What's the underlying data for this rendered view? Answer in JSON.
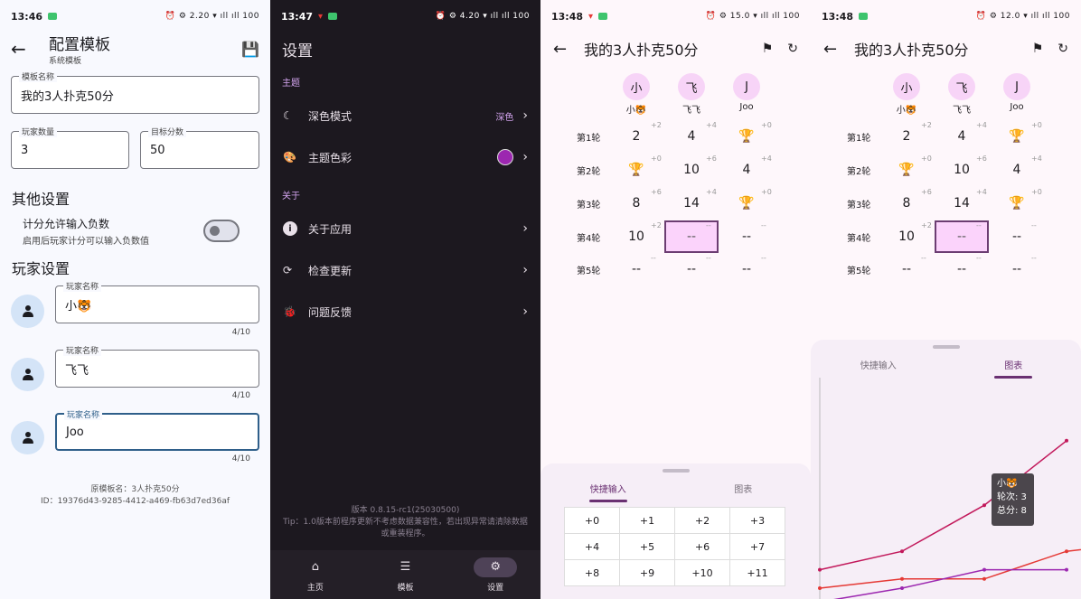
{
  "p1": {
    "time": "13:46",
    "status_right": "⏰ ⚙ 2.20 ▾ ıll ıll 100",
    "title": "配置模板",
    "subtitle": "系统模板",
    "template_name_label": "模板名称",
    "template_name_value": "我的3人扑克50分",
    "player_count_label": "玩家数量",
    "player_count_value": "3",
    "target_label": "目标分数",
    "target_value": "50",
    "other_settings": "其他设置",
    "neg_title": "计分允许输入负数",
    "neg_desc": "启用后玩家计分可以输入负数值",
    "players_section": "玩家设置",
    "player_label": "玩家名称",
    "players": [
      "小🐯",
      "飞飞",
      "Joo"
    ],
    "counters": [
      "4/10",
      "4/10",
      "4/10"
    ],
    "origin": "原模板名：3人扑克50分",
    "id": "ID：19376d43-9285-4412-a469-fb63d7ed36af"
  },
  "p2": {
    "time": "13:47",
    "status_right": "⏰ ⚙ 4.20 ▾ ıll ıll 100",
    "title": "设置",
    "sect_theme": "主题",
    "dark_mode": "深色模式",
    "dark_value": "深色",
    "theme_color": "主题色彩",
    "sect_about": "关于",
    "about_app": "关于应用",
    "check_update": "检查更新",
    "feedback": "问题反馈",
    "version": "版本 0.8.15-rc1(25030500)",
    "tip": "Tip：1.0版本前程序更新不考虑数据兼容性，若出现异常请清除数据或重装程序。",
    "nav": [
      "主页",
      "模板",
      "设置"
    ],
    "accent": "#9c27b0"
  },
  "p3": {
    "time": "13:48",
    "status_right": "⏰ ⚙ 15.0 ▾ ıll ıll 100",
    "title": "我的3人扑克50分",
    "avatars": [
      "小",
      "飞",
      "J"
    ],
    "names": [
      "小🐯",
      "飞飞",
      "Joo"
    ],
    "rounds": [
      "第1轮",
      "第2轮",
      "第3轮",
      "第4轮",
      "第5轮"
    ],
    "cells": [
      [
        "2",
        "4",
        "🏆"
      ],
      [
        "🏆",
        "10",
        "4"
      ],
      [
        "8",
        "14",
        "🏆"
      ],
      [
        "10",
        "--",
        "--"
      ],
      [
        "--",
        "--",
        "--"
      ]
    ],
    "deltas": [
      [
        "+2",
        "+4",
        "+0"
      ],
      [
        "+0",
        "+6",
        "+4"
      ],
      [
        "+6",
        "+4",
        "+0"
      ],
      [
        "+2",
        "--",
        "--"
      ],
      [
        "--",
        "--",
        "--"
      ]
    ],
    "tab_quick": "快捷输入",
    "tab_chart": "图表",
    "quick": [
      "+0",
      "+1",
      "+2",
      "+3",
      "+4",
      "+5",
      "+6",
      "+7",
      "+8",
      "+9",
      "+10",
      "+11"
    ]
  },
  "p4": {
    "time": "13:48",
    "status_right": "⏰ ⚙ 12.0 ▾ ıll ıll 100",
    "title": "我的3人扑克50分",
    "tooltip_name": "小🐯",
    "tooltip_round": "轮次: 3",
    "tooltip_total": "总分: 8"
  },
  "chart_data": {
    "type": "line",
    "x": [
      0,
      1,
      2,
      3,
      4
    ],
    "series": [
      {
        "name": "小🐯",
        "values": [
          0,
          2,
          2,
          8,
          10
        ],
        "color": "#e53935"
      },
      {
        "name": "飞飞",
        "values": [
          4,
          8,
          18,
          32
        ],
        "color": "#c2185b"
      },
      {
        "name": "Joo",
        "values": [
          -3,
          0,
          4,
          4
        ],
        "color": "#9c27b0"
      }
    ],
    "grid": false
  }
}
